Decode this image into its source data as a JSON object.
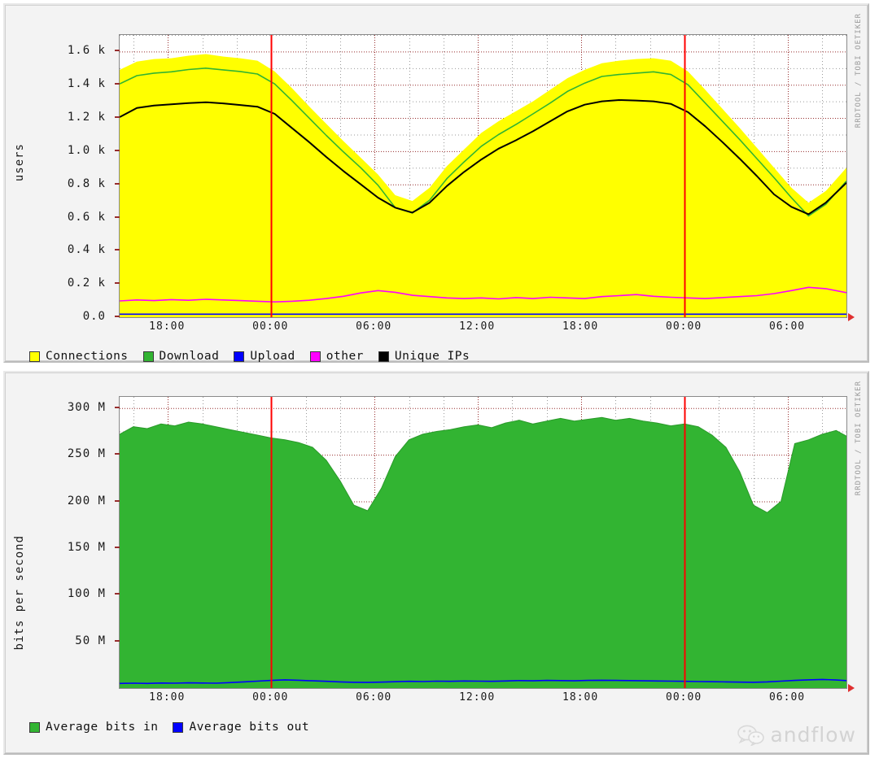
{
  "watermark": {
    "rrdtool": "RRDTOOL / TOBI OETIKER",
    "brand": "andflow",
    "brand_icon": "wechat-icon"
  },
  "panels": [
    {
      "id": "users-panel",
      "ylabel": "users",
      "legend": [
        {
          "label": "Connections",
          "color": "#ffff00",
          "icon": "legend-swatch-connections"
        },
        {
          "label": "Download",
          "color": "#32b432",
          "icon": "legend-swatch-download"
        },
        {
          "label": "Upload",
          "color": "#0000ff",
          "icon": "legend-swatch-upload"
        },
        {
          "label": "other",
          "color": "#ff00ff",
          "icon": "legend-swatch-other"
        },
        {
          "label": "Unique IPs",
          "color": "#000000",
          "icon": "legend-swatch-unique-ips"
        }
      ]
    },
    {
      "id": "bandwidth-panel",
      "ylabel": "bits per second",
      "legend": [
        {
          "label": "Average bits in",
          "color": "#32b432",
          "icon": "legend-swatch-bits-in"
        },
        {
          "label": "Average bits out",
          "color": "#0000ff",
          "icon": "legend-swatch-bits-out"
        }
      ]
    }
  ],
  "chart_data": [
    {
      "type": "area",
      "title": "",
      "xlabel": "",
      "ylabel": "users",
      "ylim": [
        0,
        1700
      ],
      "yticks": [
        0,
        200,
        400,
        600,
        800,
        1000,
        1200,
        1400,
        1600
      ],
      "ytick_labels": [
        "0.0",
        "0.2 k",
        "0.4 k",
        "0.6 k",
        "0.8 k",
        "1.0 k",
        "1.2 k",
        "1.4 k",
        "1.6 k"
      ],
      "xticks_hours": [
        18,
        24,
        30,
        36,
        42,
        48,
        54
      ],
      "xtick_labels": [
        "18:00",
        "00:00",
        "06:00",
        "12:00",
        "18:00",
        "00:00",
        "06:00"
      ],
      "x_range_hours": [
        15.2,
        57.4
      ],
      "grid": true,
      "legend_position": "below",
      "vertical_markers_hours": [
        24,
        48
      ],
      "vertical_marker_color": "#ff0000",
      "x_hours": [
        15.2,
        16.2,
        17.2,
        18.2,
        19.2,
        20.2,
        21.2,
        22.2,
        23.2,
        24.2,
        25.2,
        26.2,
        27.2,
        28.2,
        29.2,
        30.2,
        31.2,
        32.2,
        33.2,
        34.2,
        35.2,
        36.2,
        37.2,
        38.2,
        39.2,
        40.2,
        41.2,
        42.2,
        43.2,
        44.2,
        45.2,
        46.2,
        47.2,
        48.2,
        49.2,
        50.2,
        51.2,
        52.2,
        53.2,
        54.2,
        55.2,
        56.2,
        57.4
      ],
      "series": [
        {
          "name": "Connections",
          "color": "#ffff00",
          "style": "area",
          "values": [
            1490,
            1540,
            1555,
            1560,
            1575,
            1585,
            1570,
            1560,
            1545,
            1480,
            1380,
            1270,
            1165,
            1060,
            960,
            860,
            735,
            700,
            780,
            910,
            1010,
            1110,
            1180,
            1240,
            1300,
            1370,
            1440,
            1490,
            1530,
            1545,
            1555,
            1560,
            1545,
            1480,
            1370,
            1255,
            1140,
            1020,
            900,
            780,
            690,
            760,
            900
          ]
        },
        {
          "name": "Download",
          "color": "#32b432",
          "style": "line",
          "values": [
            1405,
            1455,
            1470,
            1478,
            1492,
            1500,
            1490,
            1480,
            1465,
            1405,
            1305,
            1200,
            1095,
            995,
            900,
            795,
            660,
            628,
            705,
            835,
            935,
            1030,
            1100,
            1160,
            1225,
            1290,
            1360,
            1410,
            1450,
            1462,
            1470,
            1478,
            1462,
            1400,
            1290,
            1180,
            1070,
            955,
            840,
            720,
            610,
            680,
            820
          ]
        },
        {
          "name": "Upload",
          "color": "#0000ff",
          "style": "line",
          "values": [
            18,
            18,
            18,
            18,
            18,
            18,
            18,
            18,
            18,
            18,
            18,
            18,
            18,
            18,
            18,
            18,
            18,
            18,
            18,
            18,
            18,
            18,
            18,
            18,
            18,
            18,
            18,
            18,
            18,
            18,
            18,
            18,
            18,
            18,
            18,
            18,
            18,
            18,
            18,
            18,
            18,
            18,
            18
          ]
        },
        {
          "name": "other",
          "color": "#ff00ff",
          "style": "line",
          "values": [
            98,
            104,
            100,
            106,
            102,
            108,
            104,
            100,
            96,
            92,
            96,
            102,
            112,
            126,
            146,
            160,
            150,
            132,
            124,
            116,
            112,
            116,
            110,
            118,
            112,
            120,
            116,
            112,
            124,
            130,
            136,
            126,
            120,
            116,
            112,
            118,
            124,
            130,
            142,
            160,
            180,
            172,
            148
          ]
        },
        {
          "name": "Unique IPs",
          "color": "#000000",
          "style": "line",
          "values": [
            1205,
            1260,
            1275,
            1282,
            1290,
            1295,
            1288,
            1278,
            1268,
            1225,
            1140,
            1055,
            965,
            880,
            800,
            720,
            660,
            630,
            690,
            790,
            875,
            950,
            1015,
            1065,
            1120,
            1180,
            1240,
            1280,
            1300,
            1308,
            1305,
            1300,
            1285,
            1235,
            1150,
            1055,
            955,
            850,
            740,
            665,
            620,
            690,
            810
          ]
        }
      ]
    },
    {
      "type": "area",
      "title": "",
      "xlabel": "",
      "ylabel": "bits per second",
      "ylim": [
        0,
        312000000
      ],
      "yticks": [
        50000000,
        100000000,
        150000000,
        200000000,
        250000000,
        300000000
      ],
      "ytick_labels": [
        "50 M",
        "100 M",
        "150 M",
        "200 M",
        "250 M",
        "300 M"
      ],
      "xticks_hours": [
        18,
        24,
        30,
        36,
        42,
        48,
        54
      ],
      "xtick_labels": [
        "18:00",
        "00:00",
        "06:00",
        "12:00",
        "18:00",
        "00:00",
        "06:00"
      ],
      "x_range_hours": [
        15.2,
        57.4
      ],
      "grid": true,
      "legend_position": "below",
      "vertical_markers_hours": [
        24,
        48
      ],
      "vertical_marker_color": "#ff0000",
      "x_hours": [
        15.2,
        16.0,
        16.8,
        17.6,
        18.4,
        19.2,
        20.0,
        20.8,
        21.6,
        22.4,
        23.2,
        24.0,
        24.8,
        25.6,
        26.4,
        27.2,
        28.0,
        28.8,
        29.6,
        30.4,
        31.2,
        32.0,
        32.8,
        33.6,
        34.4,
        35.2,
        36.0,
        36.8,
        37.6,
        38.4,
        39.2,
        40.0,
        40.8,
        41.6,
        42.4,
        43.2,
        44.0,
        44.8,
        45.6,
        46.4,
        47.2,
        48.0,
        48.8,
        49.6,
        50.4,
        51.2,
        52.0,
        52.8,
        53.6,
        54.4,
        55.2,
        56.0,
        56.8,
        57.4
      ],
      "series": [
        {
          "name": "Average bits in",
          "color": "#32b432",
          "style": "area",
          "values": [
            272000000,
            280000000,
            278000000,
            283000000,
            281000000,
            285000000,
            283000000,
            280000000,
            277000000,
            274000000,
            271000000,
            268000000,
            266000000,
            263000000,
            258000000,
            244000000,
            222000000,
            196000000,
            190000000,
            214000000,
            248000000,
            266000000,
            272000000,
            275000000,
            277000000,
            280000000,
            282000000,
            279000000,
            284000000,
            287000000,
            283000000,
            286000000,
            289000000,
            286000000,
            288000000,
            290000000,
            287000000,
            289000000,
            286000000,
            284000000,
            281000000,
            283000000,
            280000000,
            271000000,
            258000000,
            232000000,
            196000000,
            188000000,
            200000000,
            262000000,
            266000000,
            272000000,
            276000000,
            270000000
          ]
        },
        {
          "name": "Average bits out",
          "color": "#0000ff",
          "style": "line",
          "values": [
            5000000,
            5200000,
            5000000,
            5400000,
            5200000,
            5600000,
            5400000,
            5200000,
            5800000,
            6600000,
            7400000,
            8200000,
            8800000,
            8400000,
            7800000,
            7200000,
            6600000,
            6200000,
            6000000,
            6400000,
            6800000,
            7200000,
            7000000,
            7400000,
            7200000,
            7600000,
            7400000,
            7200000,
            7600000,
            8000000,
            7800000,
            8200000,
            8000000,
            7800000,
            8200000,
            8400000,
            8200000,
            8000000,
            7800000,
            7600000,
            7400000,
            7200000,
            7000000,
            6800000,
            6600000,
            6400000,
            6200000,
            6600000,
            7400000,
            8200000,
            8800000,
            9200000,
            8600000,
            8000000
          ]
        }
      ]
    }
  ]
}
